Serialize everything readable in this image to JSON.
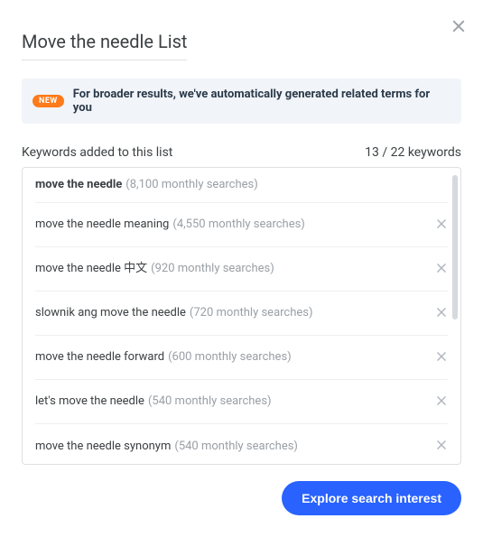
{
  "modal": {
    "title": "Move the needle List",
    "close_aria": "Close"
  },
  "banner": {
    "badge": "NEW",
    "text": "For broader results, we've automatically generated related terms for you"
  },
  "list_header": {
    "label": "Keywords added to this list",
    "current": 13,
    "total": 22,
    "suffix": "keywords"
  },
  "keywords": [
    {
      "term": "move the needle",
      "searches": "8,100",
      "bold": true,
      "removable": false
    },
    {
      "term": "move the needle meaning",
      "searches": "4,550",
      "bold": false,
      "removable": true
    },
    {
      "term": "move the needle 中文",
      "searches": "920",
      "bold": false,
      "removable": true
    },
    {
      "term": "slownik ang move the needle",
      "searches": "720",
      "bold": false,
      "removable": true
    },
    {
      "term": "move the needle forward",
      "searches": "600",
      "bold": false,
      "removable": true
    },
    {
      "term": "let's move the needle",
      "searches": "540",
      "bold": false,
      "removable": true
    },
    {
      "term": "move the needle synonym",
      "searches": "540",
      "bold": false,
      "removable": true
    }
  ],
  "meta_template": {
    "open": "(",
    "close": " monthly searches)"
  },
  "cta": {
    "label": "Explore search interest"
  }
}
